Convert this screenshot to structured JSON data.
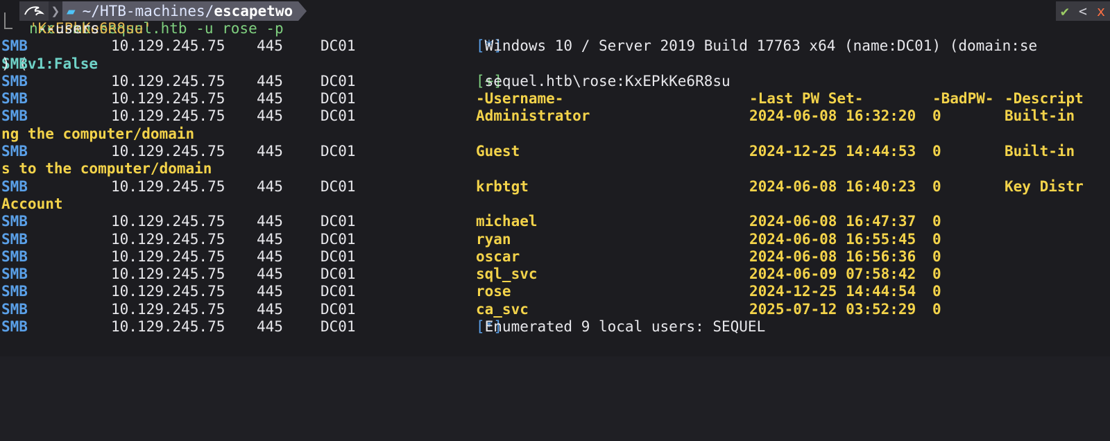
{
  "prompt": {
    "logo_icon": "kali-dragon-icon",
    "folder_icon": "folder-icon",
    "path_prefix": "~/HTB-machines/",
    "path_leaf": "escapetwo",
    "status_ok": "✔",
    "status_chevron": "<",
    "status_close": "x"
  },
  "command": {
    "prompt_char": "└─",
    "text_before": "nxc smb sequel.htb -u rose -p ",
    "password_arg": "'KxEPkKe6R8su'",
    "text_after": " --users"
  },
  "colors": {
    "smb_label": "#5aa0e8",
    "user_text": "#f3d34a",
    "success": "#7fd07f",
    "background": "#1c1c20"
  },
  "output": {
    "line1": {
      "proto": "SMB",
      "ip": "10.129.245.75",
      "port": "445",
      "host": "DC01",
      "tag": "[*]",
      "msg": " Windows 10 / Server 2019 Build 17763 x64 (name:DC01) (domain:se"
    },
    "line1_cont": {
      "open": ") (",
      "flag": "SMBv1:False",
      "close": ")"
    },
    "line2": {
      "proto": "SMB",
      "ip": "10.129.245.75",
      "port": "445",
      "host": "DC01",
      "tag": "[+]",
      "msg": " sequel.htb\\rose:KxEPkKe6R8su"
    },
    "header": {
      "proto": "SMB",
      "ip": "10.129.245.75",
      "port": "445",
      "host": "DC01",
      "username": "-Username-",
      "last_pw": "-Last PW Set-",
      "badpw": "-BadPW-",
      "desc": "-Descript"
    },
    "users": [
      {
        "proto": "SMB",
        "ip": "10.129.245.75",
        "port": "445",
        "host": "DC01",
        "username": "Administrator",
        "last_pw": "2024-06-08 16:32:20",
        "badpw": "0",
        "desc": "Built-in",
        "cont": "ng the computer/domain"
      },
      {
        "proto": "SMB",
        "ip": "10.129.245.75",
        "port": "445",
        "host": "DC01",
        "username": "Guest",
        "last_pw": "2024-12-25 14:44:53",
        "badpw": "0",
        "desc": "Built-in",
        "cont": "s to the computer/domain"
      },
      {
        "proto": "SMB",
        "ip": "10.129.245.75",
        "port": "445",
        "host": "DC01",
        "username": "krbtgt",
        "last_pw": "2024-06-08 16:40:23",
        "badpw": "0",
        "desc": "Key Distr",
        "cont": "Account"
      },
      {
        "proto": "SMB",
        "ip": "10.129.245.75",
        "port": "445",
        "host": "DC01",
        "username": "michael",
        "last_pw": "2024-06-08 16:47:37",
        "badpw": "0",
        "desc": ""
      },
      {
        "proto": "SMB",
        "ip": "10.129.245.75",
        "port": "445",
        "host": "DC01",
        "username": "ryan",
        "last_pw": "2024-06-08 16:55:45",
        "badpw": "0",
        "desc": ""
      },
      {
        "proto": "SMB",
        "ip": "10.129.245.75",
        "port": "445",
        "host": "DC01",
        "username": "oscar",
        "last_pw": "2024-06-08 16:56:36",
        "badpw": "0",
        "desc": ""
      },
      {
        "proto": "SMB",
        "ip": "10.129.245.75",
        "port": "445",
        "host": "DC01",
        "username": "sql_svc",
        "last_pw": "2024-06-09 07:58:42",
        "badpw": "0",
        "desc": ""
      },
      {
        "proto": "SMB",
        "ip": "10.129.245.75",
        "port": "445",
        "host": "DC01",
        "username": "rose",
        "last_pw": "2024-12-25 14:44:54",
        "badpw": "0",
        "desc": ""
      },
      {
        "proto": "SMB",
        "ip": "10.129.245.75",
        "port": "445",
        "host": "DC01",
        "username": "ca_svc",
        "last_pw": "2025-07-12 03:52:29",
        "badpw": "0",
        "desc": ""
      }
    ],
    "summary": {
      "proto": "SMB",
      "ip": "10.129.245.75",
      "port": "445",
      "host": "DC01",
      "tag": "[*]",
      "msg": " Enumerated 9 local users: SEQUEL"
    }
  }
}
